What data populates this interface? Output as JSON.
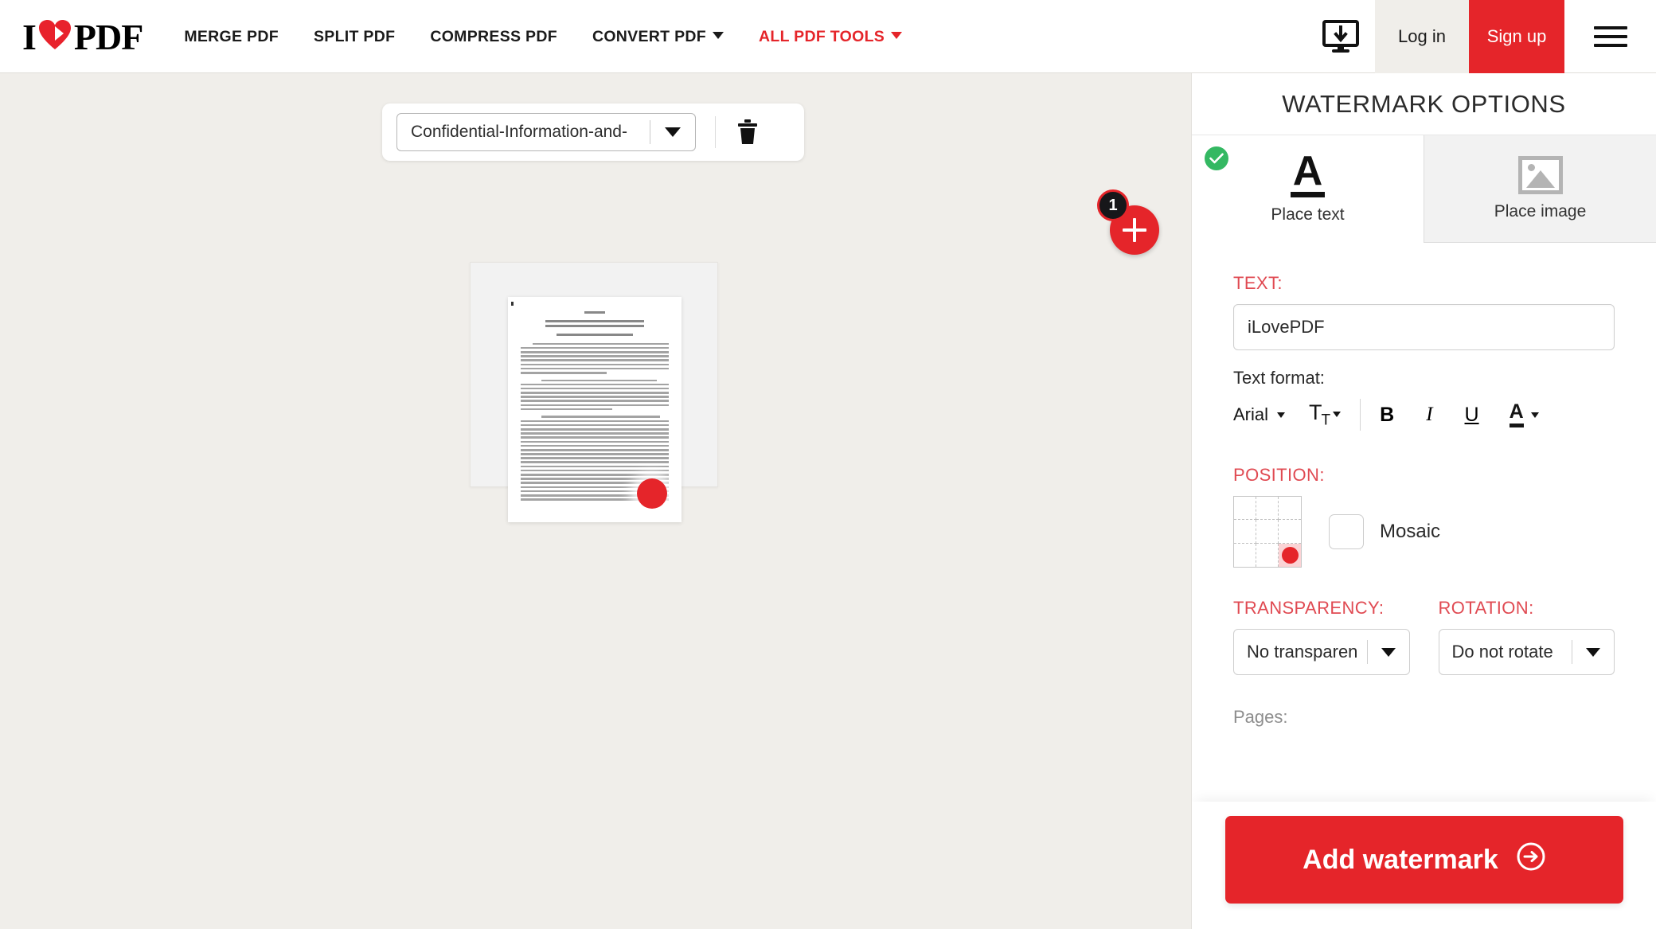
{
  "header": {
    "logo": {
      "i": "I",
      "heart_icon": "heart-icon",
      "pdf": "PDF"
    },
    "nav": [
      {
        "label": "MERGE PDF",
        "has_caret": false,
        "red": false
      },
      {
        "label": "SPLIT PDF",
        "has_caret": false,
        "red": false
      },
      {
        "label": "COMPRESS PDF",
        "has_caret": false,
        "red": false
      },
      {
        "label": "CONVERT PDF",
        "has_caret": true,
        "red": false
      },
      {
        "label": "ALL PDF TOOLS",
        "has_caret": true,
        "red": true
      }
    ],
    "desktop_icon": "desktop-download-icon",
    "login_label": "Log in",
    "signup_label": "Sign up",
    "menu_icon": "hamburger-menu-icon"
  },
  "workspace": {
    "file_name": "Confidential-Information-and-",
    "file_dropdown_icon": "chevron-down-icon",
    "delete_icon": "trash-icon",
    "add_file_icon": "plus-icon",
    "file_count_badge": "1",
    "document": {
      "title_line_1": "CONFIDENTIAL INFORMATION AND",
      "title_line_2": "INVENTION ASSIGNMENT AGREEMENT",
      "watermark_marker": "watermark-position-marker"
    }
  },
  "panel": {
    "title": "WATERMARK OPTIONS",
    "tabs": [
      {
        "label": "Place text",
        "icon": "letter-a-icon",
        "selected": true
      },
      {
        "label": "Place image",
        "icon": "image-icon",
        "selected": false
      }
    ],
    "selected_check_icon": "check-circle-icon",
    "text_section": {
      "label": "TEXT:",
      "value": "iLovePDF",
      "placeholder": "iLovePDF"
    },
    "format": {
      "label": "Text format:",
      "font": "Arial",
      "size_icon": "font-size-icon",
      "bold": "B",
      "italic": "I",
      "underline": "U",
      "color": "A"
    },
    "position": {
      "label": "POSITION:",
      "selected_cell": 9,
      "mosaic_label": "Mosaic",
      "mosaic_checked": false
    },
    "transparency": {
      "label": "TRANSPARENCY:",
      "value": "No transparen"
    },
    "rotation": {
      "label": "ROTATION:",
      "value": "Do not rotate"
    },
    "pages_label": "Pages:",
    "cta": {
      "label": "Add watermark",
      "icon": "arrow-right-circle-icon"
    }
  },
  "colors": {
    "brand_red": "#e5252a",
    "label_red": "#e04a52",
    "workspace_bg": "#f0eeea",
    "check_green": "#34b862"
  }
}
